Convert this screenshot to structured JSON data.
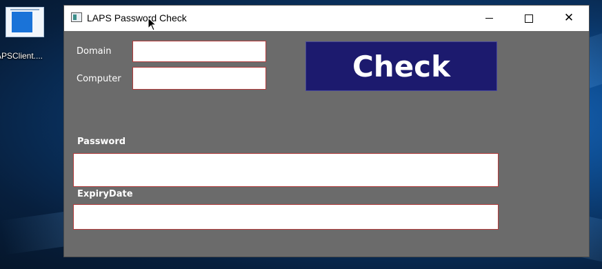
{
  "desktop": {
    "icon_label": "APSClient...."
  },
  "window": {
    "title": "LAPS Password Check",
    "controls": {
      "minimize": "minimize",
      "maximize": "maximize",
      "close": "close"
    }
  },
  "form": {
    "domain_label": "Domain",
    "domain_value": "",
    "computer_label": "Computer",
    "computer_value": "",
    "check_button": "Check",
    "password_label": "Password",
    "password_value": "",
    "expiry_label": "ExpiryDate",
    "expiry_value": ""
  },
  "colors": {
    "window_bg": "#6b6b6b",
    "button_bg": "#1c1a6e",
    "field_border": "#b23a3a"
  }
}
